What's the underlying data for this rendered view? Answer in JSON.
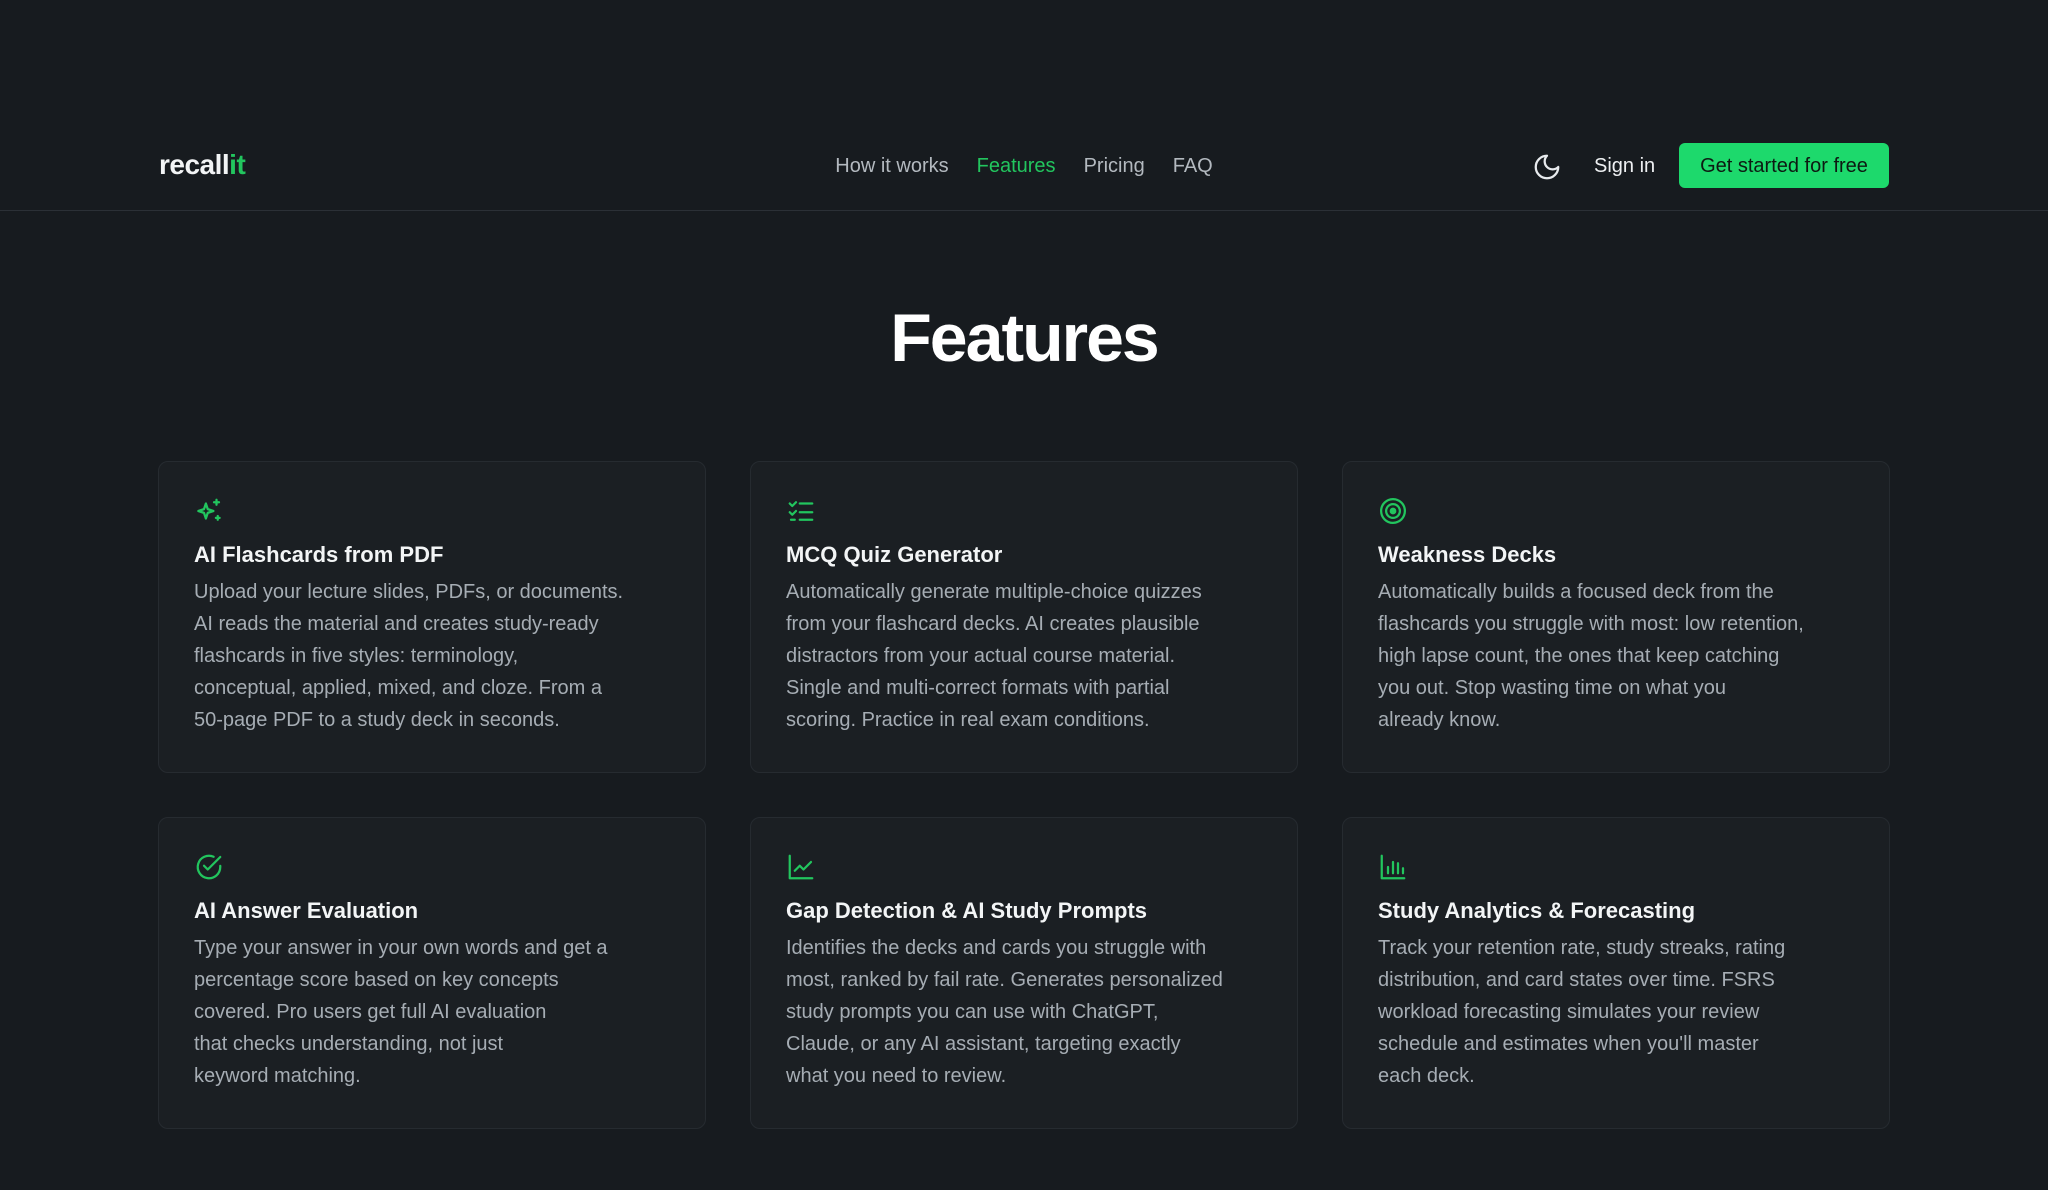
{
  "brand": {
    "name_main": "recall",
    "name_accent": "it",
    "accent_color": "#22c55e"
  },
  "nav": {
    "items": [
      {
        "label": "How it works",
        "active": false
      },
      {
        "label": "Features",
        "active": true
      },
      {
        "label": "Pricing",
        "active": false
      },
      {
        "label": "FAQ",
        "active": false
      }
    ]
  },
  "header_actions": {
    "theme_toggle_icon": "moon-icon",
    "sign_in": "Sign in",
    "cta": "Get started for free"
  },
  "section": {
    "title": "Features",
    "cards": [
      {
        "icon": "sparkles-icon",
        "title": "AI Flashcards from PDF",
        "text": "Upload your lecture slides, PDFs, or documents.\nAI reads the material and creates study-ready\nflashcards in five styles: terminology,\nconceptual, applied, mixed, and cloze. From a\n50-page PDF to a study deck in seconds."
      },
      {
        "icon": "list-checks-icon",
        "title": "MCQ Quiz Generator",
        "text": "Automatically generate multiple-choice quizzes\nfrom your flashcard decks. AI creates plausible\ndistractors from your actual course material.\nSingle and multi-correct formats with partial\nscoring. Practice in real exam conditions."
      },
      {
        "icon": "target-icon",
        "title": "Weakness Decks",
        "text": "Automatically builds a focused deck from the\nflashcards you struggle with most: low retention,\nhigh lapse count, the ones that keep catching\nyou out. Stop wasting time on what you\nalready know."
      },
      {
        "icon": "check-circle-icon",
        "title": "AI Answer Evaluation",
        "text": "Type your answer in your own words and get a\npercentage score based on key concepts\ncovered. Pro users get full AI evaluation\nthat checks understanding, not just\nkeyword matching."
      },
      {
        "icon": "line-chart-icon",
        "title": "Gap Detection & AI Study Prompts",
        "text": "Identifies the decks and cards you struggle with\nmost, ranked by fail rate. Generates personalized\nstudy prompts you can use with ChatGPT,\nClaude, or any AI assistant, targeting exactly\nwhat you need to review."
      },
      {
        "icon": "bar-chart-icon",
        "title": "Study Analytics & Forecasting",
        "text": "Track your retention rate, study streaks, rating\ndistribution, and card states over time. FSRS\nworkload forecasting simulates your review\nschedule and estimates when you'll master\neach deck."
      }
    ]
  }
}
